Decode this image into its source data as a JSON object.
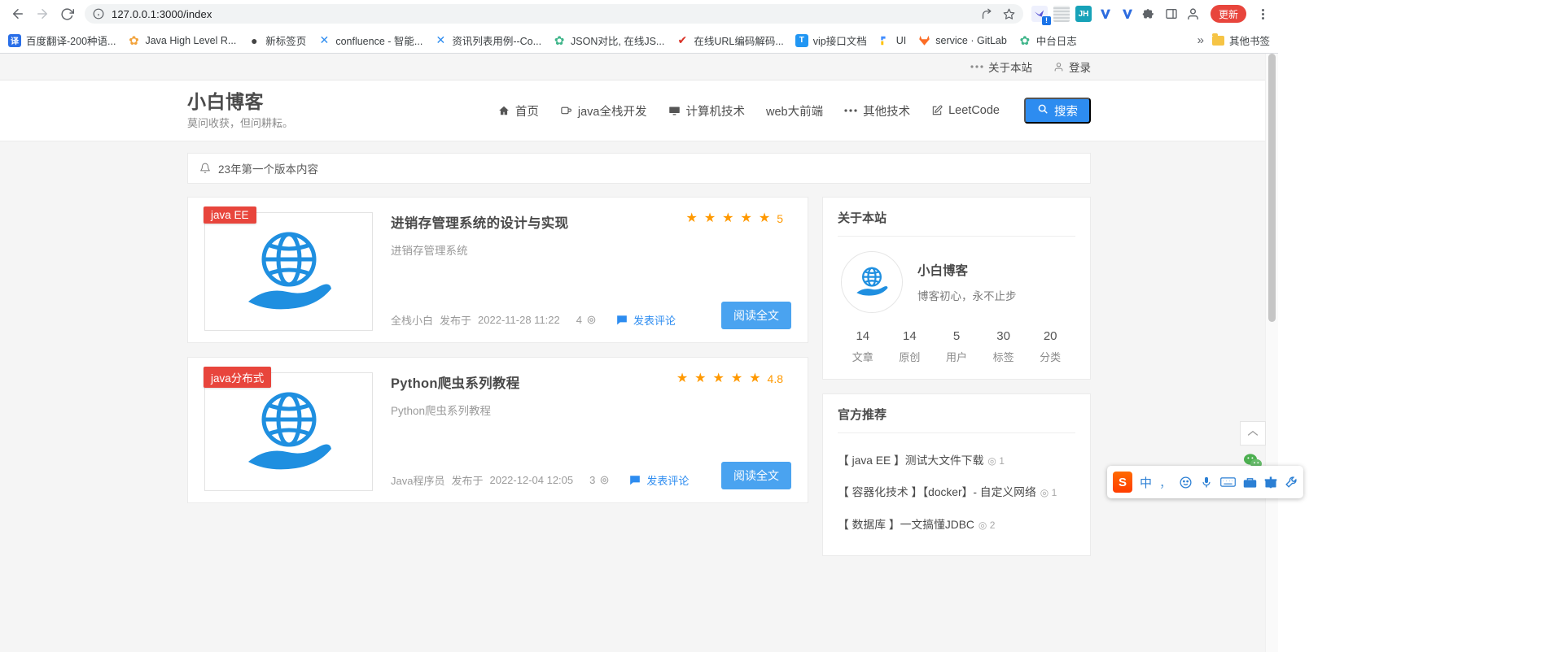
{
  "browser": {
    "url": "127.0.0.1:3000/index",
    "nav": {
      "back_label": "back-arrow",
      "forward_label": "forward-arrow",
      "reload_label": "reload"
    },
    "update_button": "更新",
    "bookmarks": [
      {
        "label": "百度翻译-200种语...",
        "icon": "译",
        "color": "#2a6fe8"
      },
      {
        "label": "Java High Level R...",
        "icon": "✿",
        "color": "#f2a33c"
      },
      {
        "label": "新标签页",
        "icon": "●",
        "color": "#444444"
      },
      {
        "label": "confluence - 智能...",
        "icon": "✕",
        "color": "#2d8cf0"
      },
      {
        "label": "资讯列表用例--Co...",
        "icon": "✕",
        "color": "#2d8cf0"
      },
      {
        "label": "JSON对比, 在线JS...",
        "icon": "✿",
        "color": "#3fb58a"
      },
      {
        "label": "在线URL编码解码...",
        "icon": "✔",
        "color": "#d93025"
      },
      {
        "label": "vip接口文档",
        "icon": "T",
        "color": "#2196f3"
      },
      {
        "label": "UI",
        "icon": "◤",
        "color": "#1a73e8"
      },
      {
        "label": "service · GitLab",
        "icon": "🦊",
        "color": "#fc6d26"
      },
      {
        "label": "中台日志",
        "icon": "✿",
        "color": "#3fb58a"
      }
    ],
    "bookmarks_overflow": "»",
    "other_bookmarks": "其他书签"
  },
  "site": {
    "topbar": {
      "about_label": "关于本站",
      "login_label": "登录"
    },
    "brand": {
      "title": "小白博客",
      "subtitle": "莫问收获，但问耕耘。"
    },
    "nav": [
      {
        "label": "首页",
        "icon": "home-icon"
      },
      {
        "label": "java全栈开发",
        "icon": "mug-icon"
      },
      {
        "label": "计算机技术",
        "icon": "monitor-icon"
      },
      {
        "label": "web大前端",
        "icon": "none"
      },
      {
        "label": "其他技术",
        "icon": "dots-icon"
      },
      {
        "label": "LeetCode",
        "icon": "edit-icon"
      }
    ],
    "search_button": "搜索",
    "notice": "23年第一个版本内容",
    "articles": [
      {
        "tag": "java EE",
        "title": "进销存管理系统的设计与实现",
        "summary": "进销存管理系统",
        "rating": "5",
        "stars": 5,
        "author": "全栈小白",
        "published_prefix": "发布于",
        "date": "2022-11-28 11:22",
        "views": "4",
        "comment_label": "发表评论",
        "read_more": "阅读全文"
      },
      {
        "tag": "java分布式",
        "title": "Python爬虫系列教程",
        "summary": "Python爬虫系列教程",
        "rating": "4.8",
        "stars": 5,
        "author": "Java程序员",
        "published_prefix": "发布于",
        "date": "2022-12-04 12:05",
        "views": "3",
        "comment_label": "发表评论",
        "read_more": "阅读全文"
      }
    ],
    "about_card": {
      "title": "关于本站",
      "name": "小白博客",
      "desc": "博客初心，永不止步",
      "stats": [
        {
          "num": "14",
          "label": "文章"
        },
        {
          "num": "14",
          "label": "原创"
        },
        {
          "num": "5",
          "label": "用户"
        },
        {
          "num": "30",
          "label": "标签"
        },
        {
          "num": "20",
          "label": "分类"
        }
      ]
    },
    "recommend_card": {
      "title": "官方推荐",
      "items": [
        {
          "text": "【 java EE 】测试大文件下载",
          "views": "1"
        },
        {
          "text": "【 容器化技术 】【docker】- 自定义网络",
          "views": "1"
        },
        {
          "text": "【 数据库 】一文搞懂JDBC",
          "views": "2"
        }
      ]
    }
  },
  "ime": {
    "logo": "S",
    "mode": "中",
    "items": [
      "中",
      "，",
      "☺",
      "🎤",
      "⌨",
      "🗂",
      "🎁",
      "🔧"
    ]
  }
}
